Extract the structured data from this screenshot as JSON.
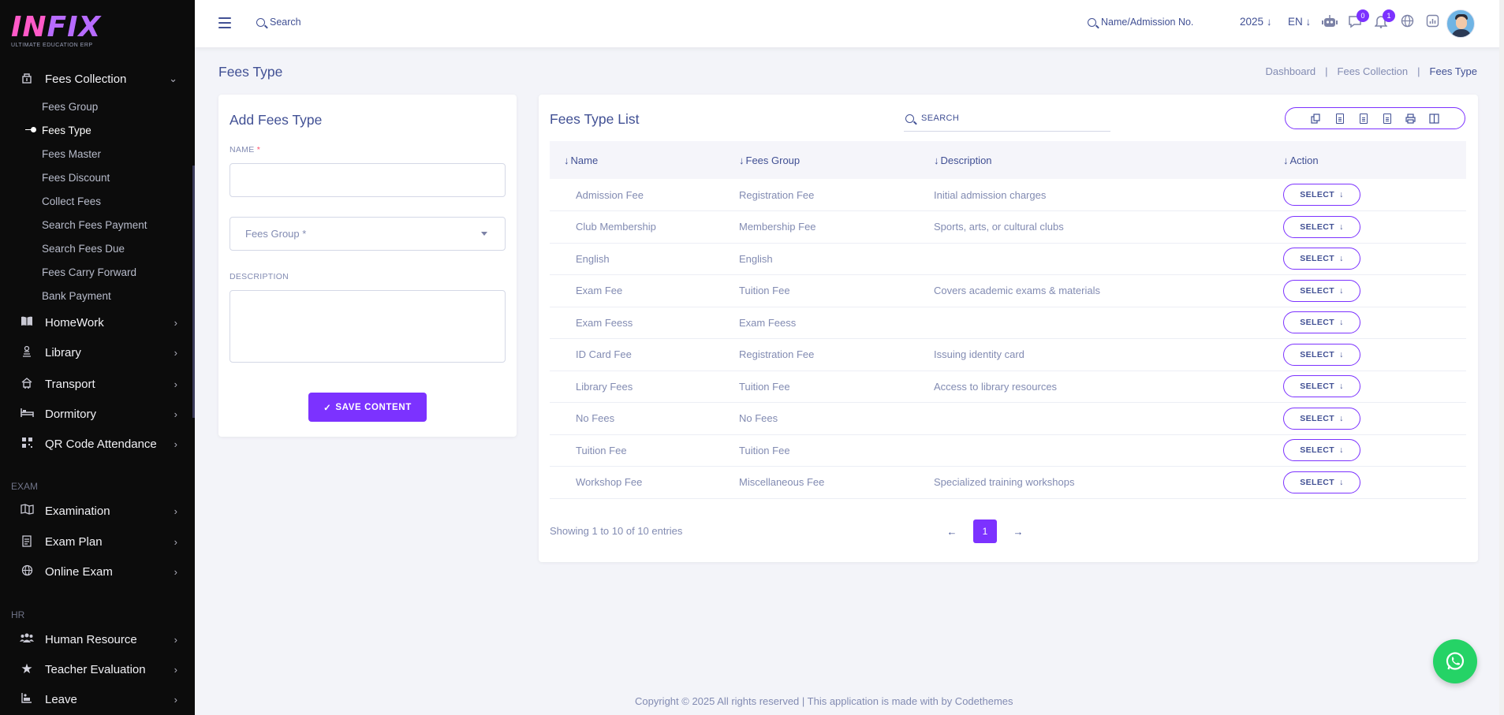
{
  "brand": {
    "logo_main": "IN",
    "logo_accent": "FIX",
    "logo_sub": "ULTIMATE EDUCATION ERP"
  },
  "sidebar": {
    "fees_collection": {
      "label": "Fees Collection",
      "children": [
        {
          "label": "Fees Group"
        },
        {
          "label": "Fees Type"
        },
        {
          "label": "Fees Master"
        },
        {
          "label": "Fees Discount"
        },
        {
          "label": "Collect Fees"
        },
        {
          "label": "Search Fees Payment"
        },
        {
          "label": "Search Fees Due"
        },
        {
          "label": "Fees Carry Forward"
        },
        {
          "label": "Bank Payment"
        }
      ]
    },
    "items": [
      {
        "label": "HomeWork",
        "icon": "book-icon"
      },
      {
        "label": "Library",
        "icon": "library-icon"
      },
      {
        "label": "Transport",
        "icon": "bus-icon"
      },
      {
        "label": "Dormitory",
        "icon": "bed-icon"
      },
      {
        "label": "QR Code Attendance",
        "icon": "qr-code-icon"
      }
    ],
    "section_exam": "EXAM",
    "exam_items": [
      {
        "label": "Examination",
        "icon": "map-icon"
      },
      {
        "label": "Exam Plan",
        "icon": "clipboard-icon"
      },
      {
        "label": "Online Exam",
        "icon": "globe-icon"
      }
    ],
    "section_hr": "HR",
    "hr_items": [
      {
        "label": "Human Resource",
        "icon": "people-icon"
      },
      {
        "label": "Teacher Evaluation",
        "icon": "star-icon"
      },
      {
        "label": "Leave",
        "icon": "leave-icon"
      }
    ]
  },
  "topbar": {
    "search_label": "Search",
    "student_search_label": "Name/Admission No.",
    "year": "2025",
    "language": "EN",
    "chat_count": "0",
    "notification_count": "1"
  },
  "page": {
    "title": "Fees Type",
    "breadcrumb": [
      "Dashboard",
      "Fees Collection",
      "Fees Type"
    ]
  },
  "form": {
    "title": "Add Fees Type",
    "name_label": "NAME",
    "required_mark": "*",
    "fees_group_placeholder": "Fees Group *",
    "description_label": "DESCRIPTION",
    "save_label": "SAVE CONTENT"
  },
  "list": {
    "title": "Fees Type List",
    "search_placeholder": "SEARCH",
    "columns": [
      "Name",
      "Fees Group",
      "Description",
      "Action"
    ],
    "action_label": "SELECT",
    "rows": [
      {
        "name": "Admission Fee",
        "group": "Registration Fee",
        "description": "Initial admission charges"
      },
      {
        "name": "Club Membership",
        "group": "Membership Fee",
        "description": "Sports, arts, or cultural clubs"
      },
      {
        "name": "English",
        "group": "English",
        "description": ""
      },
      {
        "name": "Exam Fee",
        "group": "Tuition Fee",
        "description": "Covers academic exams & materials"
      },
      {
        "name": "Exam Feess",
        "group": "Exam Feess",
        "description": ""
      },
      {
        "name": "ID Card Fee",
        "group": "Registration Fee",
        "description": "Issuing identity card"
      },
      {
        "name": "Library Fees",
        "group": "Tuition Fee",
        "description": "Access to library resources"
      },
      {
        "name": "No Fees",
        "group": "No Fees",
        "description": ""
      },
      {
        "name": "Tuition Fee",
        "group": "Tuition Fee",
        "description": ""
      },
      {
        "name": "Workshop Fee",
        "group": "Miscellaneous Fee",
        "description": "Specialized training workshops"
      }
    ],
    "showing_text": "Showing 1 to 10 of 10 entries",
    "current_page": "1"
  },
  "footer": {
    "copyright": "Copyright © 2025 All rights reserved | This application is made with by Codethemes"
  },
  "colors": {
    "accent": "#7c32ff",
    "text": "#415094",
    "muted": "#828bb2",
    "sidebar_bg": "#0c0c0c",
    "whatsapp": "#25d366"
  }
}
